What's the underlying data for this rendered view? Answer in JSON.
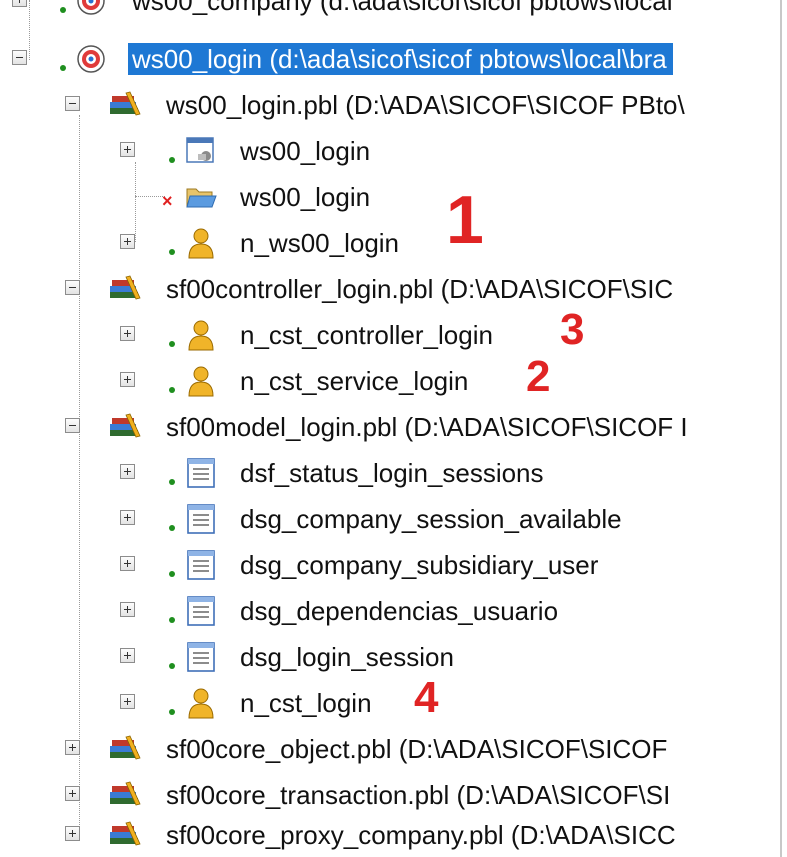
{
  "tree": {
    "rows": [
      {
        "label": "ws00_company (d:\\ada\\sicof\\sicof pbtows\\local",
        "icon": "target-app-icon",
        "level": 0
      },
      {
        "label": "ws00_login (d:\\ada\\sicof\\sicof pbtows\\local\\bra",
        "icon": "target-app-icon",
        "level": 0,
        "selected": true
      },
      {
        "label": "ws00_login.pbl (D:\\ADA\\SICOF\\SICOF PBto\\",
        "icon": "library-books-icon",
        "level": 1
      },
      {
        "label": "ws00_login",
        "icon": "window-object-icon",
        "level": 2
      },
      {
        "label": "ws00_login",
        "icon": "folder-open-icon",
        "level": 2
      },
      {
        "label": "n_ws00_login",
        "icon": "user-object-icon",
        "level": 2
      },
      {
        "label": "sf00controller_login.pbl (D:\\ADA\\SICOF\\SIC",
        "icon": "library-books-icon",
        "level": 1
      },
      {
        "label": "n_cst_controller_login",
        "icon": "user-object-icon",
        "level": 2
      },
      {
        "label": "n_cst_service_login",
        "icon": "user-object-icon",
        "level": 2
      },
      {
        "label": "sf00model_login.pbl (D:\\ADA\\SICOF\\SICOF I",
        "icon": "library-books-icon",
        "level": 1
      },
      {
        "label": "dsf_status_login_sessions",
        "icon": "datawindow-icon",
        "level": 2
      },
      {
        "label": "dsg_company_session_available",
        "icon": "datawindow-icon",
        "level": 2
      },
      {
        "label": "dsg_company_subsidiary_user",
        "icon": "datawindow-icon",
        "level": 2
      },
      {
        "label": "dsg_dependencias_usuario",
        "icon": "datawindow-icon",
        "level": 2
      },
      {
        "label": "dsg_login_session",
        "icon": "datawindow-icon",
        "level": 2
      },
      {
        "label": "n_cst_login",
        "icon": "user-object-icon",
        "level": 2
      },
      {
        "label": "sf00core_object.pbl (D:\\ADA\\SICOF\\SICOF",
        "icon": "library-books-icon",
        "level": 1
      },
      {
        "label": "sf00core_transaction.pbl (D:\\ADA\\SICOF\\SI",
        "icon": "library-books-icon",
        "level": 1
      },
      {
        "label": "sf00core_proxy_company.pbl (D:\\ADA\\SICC",
        "icon": "library-books-icon",
        "level": 1
      }
    ]
  },
  "annotations": {
    "n1": "1",
    "n2": "2",
    "n3": "3",
    "n4": "4"
  },
  "colors": {
    "selection": "#1e78d4",
    "annotation": "#e02424",
    "status_dot": "#1f8f1f"
  }
}
